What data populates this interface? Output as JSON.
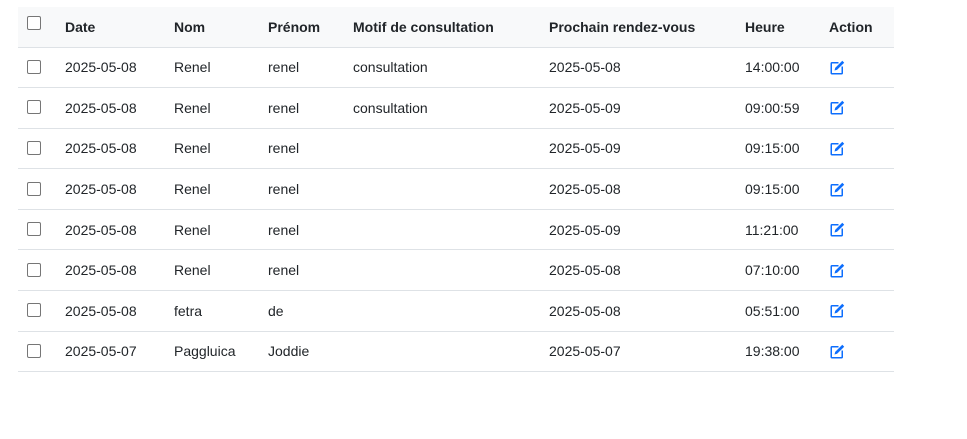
{
  "table": {
    "headers": {
      "date": "Date",
      "nom": "Nom",
      "prenom": "Prénom",
      "motif": "Motif de consultation",
      "prochain": "Prochain rendez-vous",
      "heure": "Heure",
      "action": "Action"
    },
    "rows": [
      {
        "date": "2025-05-08",
        "nom": "Renel",
        "prenom": "renel",
        "motif": "consultation",
        "prochain": "2025-05-08",
        "heure": "14:00:00"
      },
      {
        "date": "2025-05-08",
        "nom": "Renel",
        "prenom": "renel",
        "motif": "consultation",
        "prochain": "2025-05-09",
        "heure": "09:00:59"
      },
      {
        "date": "2025-05-08",
        "nom": "Renel",
        "prenom": "renel",
        "motif": "",
        "prochain": "2025-05-09",
        "heure": "09:15:00"
      },
      {
        "date": "2025-05-08",
        "nom": "Renel",
        "prenom": "renel",
        "motif": "",
        "prochain": "2025-05-08",
        "heure": "09:15:00"
      },
      {
        "date": "2025-05-08",
        "nom": "Renel",
        "prenom": "renel",
        "motif": "",
        "prochain": "2025-05-09",
        "heure": "11:21:00"
      },
      {
        "date": "2025-05-08",
        "nom": "Renel",
        "prenom": "renel",
        "motif": "",
        "prochain": "2025-05-08",
        "heure": "07:10:00"
      },
      {
        "date": "2025-05-08",
        "nom": "fetra",
        "prenom": "de",
        "motif": "",
        "prochain": "2025-05-08",
        "heure": "05:51:00"
      },
      {
        "date": "2025-05-07",
        "nom": "Paggluica",
        "prenom": "Joddie",
        "motif": "",
        "prochain": "2025-05-07",
        "heure": "19:38:00"
      }
    ]
  },
  "icons": {
    "edit": "edit-icon",
    "checkbox": "checkbox"
  },
  "colors": {
    "accent": "#0d6efd",
    "header_bg": "#f8f9fa",
    "border": "#dee2e6"
  }
}
